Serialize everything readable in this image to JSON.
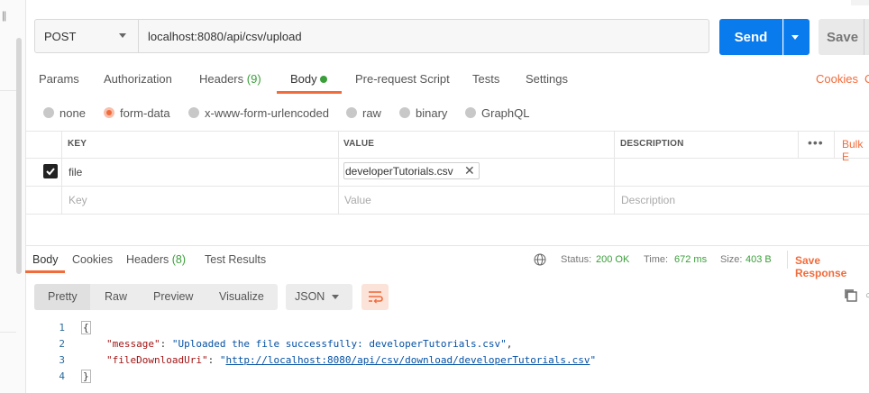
{
  "left": {
    "pause_icon": "pause-icon"
  },
  "request": {
    "method": "POST",
    "url": "localhost:8080/api/csv/upload",
    "send_label": "Send",
    "save_label": "Save"
  },
  "req_tabs": {
    "params": "Params",
    "authorization": "Authorization",
    "headers": "Headers",
    "headers_count": "(9)",
    "body": "Body",
    "pre_request": "Pre-request Script",
    "tests": "Tests",
    "settings": "Settings",
    "cookies": "Cookies",
    "cookies_cut": "C"
  },
  "body_types": {
    "none": "none",
    "form_data": "form-data",
    "urlencoded": "x-www-form-urlencoded",
    "raw": "raw",
    "binary": "binary",
    "graphql": "GraphQL"
  },
  "table": {
    "headers": {
      "key": "KEY",
      "value": "VALUE",
      "description": "DESCRIPTION",
      "bulk": "Bulk E"
    },
    "row": {
      "key": "file",
      "value": "developerTutorials.csv"
    },
    "placeholders": {
      "key": "Key",
      "value": "Value",
      "description": "Description"
    }
  },
  "response": {
    "tabs": {
      "body": "Body",
      "cookies": "Cookies",
      "headers": "Headers",
      "headers_count": "(8)",
      "test_results": "Test Results"
    },
    "status_label": "Status:",
    "status_value": "200 OK",
    "time_label": "Time:",
    "time_value": "672 ms",
    "size_label": "Size:",
    "size_value": "403 B",
    "save_response": "Save Response",
    "formats": {
      "pretty": "Pretty",
      "raw": "Raw",
      "preview": "Preview",
      "visualize": "Visualize"
    },
    "lang": "JSON",
    "code": {
      "line_numbers": [
        "1",
        "2",
        "3",
        "4"
      ],
      "open_brace": "{",
      "close_brace": "}",
      "key1": "\"message\"",
      "val1": "\"Uploaded the file successfully: developerTutorials.csv\"",
      "key2": "\"fileDownloadUri\"",
      "val2_q": "\"",
      "val2": "http://localhost:8080/api/csv/download/developerTutorials.csv",
      "colon": ": ",
      "comma": ","
    }
  },
  "colors": {
    "accent": "#f26b3a",
    "send": "#097bed",
    "ok": "#3a9e3a"
  }
}
